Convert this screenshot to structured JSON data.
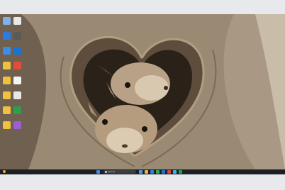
{
  "wallpaper": {
    "subject": ""
  },
  "desktop": {
    "icons": [
      {
        "name": "desktop-icon",
        "color": "#7fb2e6"
      },
      {
        "name": "desktop-icon",
        "color": "#e8e8e8"
      },
      {
        "name": "desktop-icon",
        "color": "#2d7be0"
      },
      {
        "name": "desktop-icon",
        "color": "#5a5a5a"
      },
      {
        "name": "desktop-icon",
        "color": "#3a8ee6"
      },
      {
        "name": "desktop-icon",
        "color": "#1b73d1"
      },
      {
        "name": "desktop-icon",
        "color": "#f0c040"
      },
      {
        "name": "desktop-icon",
        "color": "#e34b3a"
      },
      {
        "name": "desktop-icon",
        "color": "#f0c040"
      },
      {
        "name": "desktop-icon",
        "color": "#f4f4f4"
      },
      {
        "name": "desktop-icon",
        "color": "#f0c040"
      },
      {
        "name": "desktop-icon",
        "color": "#e8e8e8"
      },
      {
        "name": "desktop-icon",
        "color": "#f0c040"
      },
      {
        "name": "desktop-icon",
        "color": "#2c9e4e"
      },
      {
        "name": "desktop-icon",
        "color": "#f0c040"
      },
      {
        "name": "desktop-icon",
        "color": "#9a5fd6"
      }
    ]
  },
  "taskbar": {
    "weather_text": "",
    "search_placeholder": "Search",
    "apps": [
      {
        "name": "app-icon",
        "color": "#4a9af0"
      },
      {
        "name": "app-icon",
        "color": "#e9b63b"
      },
      {
        "name": "app-icon",
        "color": "#2f7fd8"
      },
      {
        "name": "app-icon",
        "color": "#35a853"
      },
      {
        "name": "app-icon",
        "color": "#0e7bd5"
      },
      {
        "name": "app-icon",
        "color": "#d6463b"
      },
      {
        "name": "app-icon",
        "color": "#3bb7e8"
      },
      {
        "name": "app-icon",
        "color": "#1a9e5c"
      }
    ],
    "clock_time": "",
    "clock_date": ""
  }
}
